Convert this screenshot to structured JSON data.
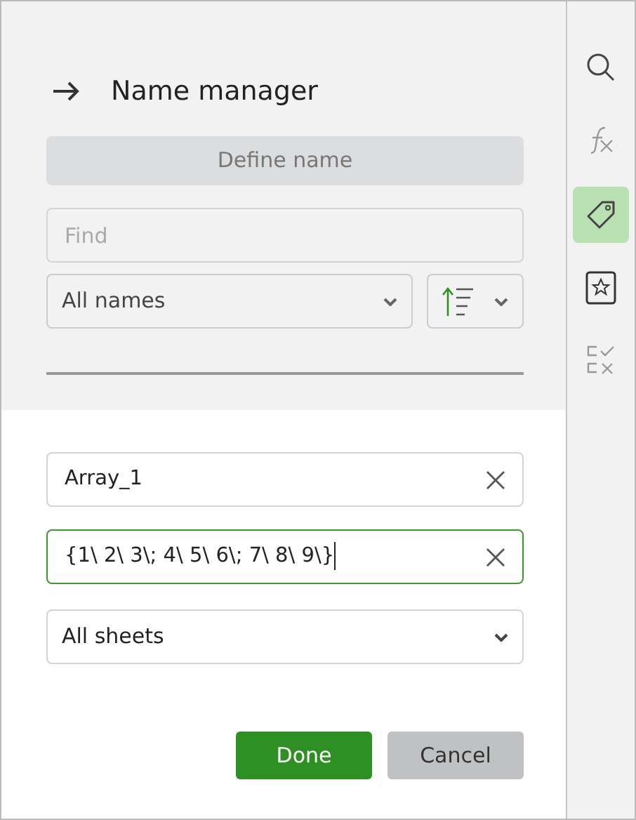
{
  "panel": {
    "title": "Name manager",
    "define_button": {
      "label": "Define name",
      "disabled": true
    },
    "find": {
      "placeholder": "Find"
    },
    "filter": {
      "value": "All names"
    }
  },
  "editor": {
    "name_field": {
      "value": "Array_1",
      "focused": false
    },
    "formula_field": {
      "value": "{1\\ 2\\ 3\\; 4\\ 5\\ 6\\; 7\\ 8\\ 9\\}",
      "focused": true
    },
    "scope": {
      "value": "All sheets"
    },
    "buttons": [
      {
        "label": "Done",
        "kind": "primary"
      },
      {
        "label": "Cancel",
        "kind": "secondary"
      }
    ]
  },
  "sidebar": {
    "items": [
      {
        "kind": "search",
        "selected": false
      },
      {
        "kind": "function",
        "selected": false
      },
      {
        "kind": "tag",
        "selected": true
      },
      {
        "kind": "star",
        "selected": false
      },
      {
        "kind": "checklist",
        "selected": false
      }
    ]
  }
}
